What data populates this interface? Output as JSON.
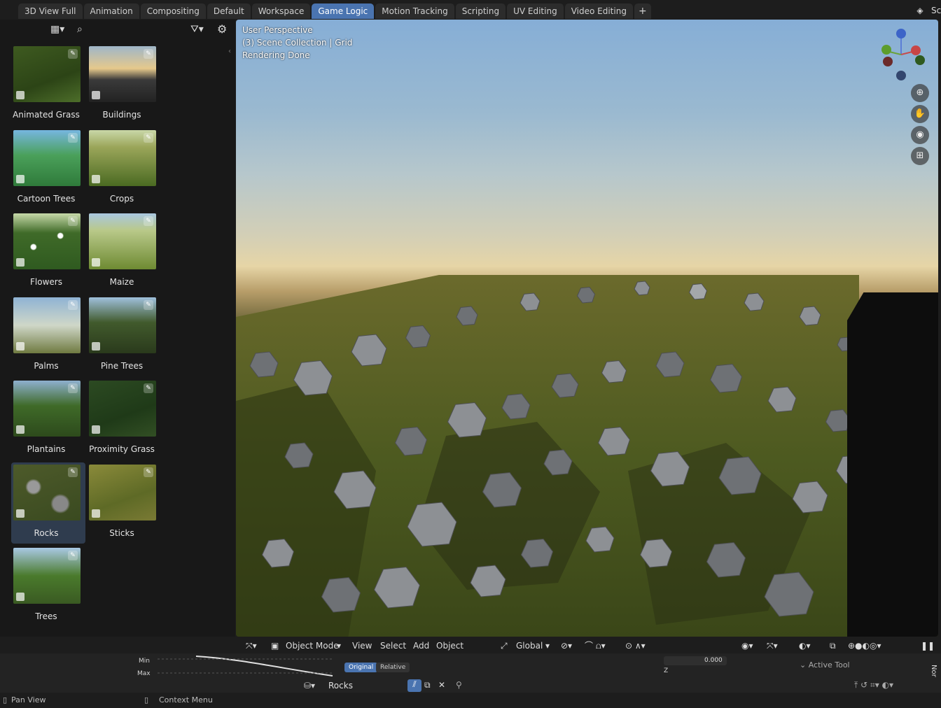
{
  "workspace_tabs": [
    "3D View Full",
    "Animation",
    "Compositing",
    "Default",
    "Workspace",
    "Game Logic",
    "Motion Tracking",
    "Scripting",
    "UV Editing",
    "Video Editing"
  ],
  "active_tab": "Game Logic",
  "add_tab_label": "+",
  "top_right": {
    "scene_abbrev": "Sc"
  },
  "assets": [
    {
      "label": "Animated Grass",
      "icon": "grass-thumbnail"
    },
    {
      "label": "Buildings",
      "icon": "buildings-thumbnail"
    },
    {
      "label": "Cartoon Trees",
      "icon": "cartoon-trees-thumbnail"
    },
    {
      "label": "Crops",
      "icon": "crops-thumbnail"
    },
    {
      "label": "Flowers",
      "icon": "flowers-thumbnail"
    },
    {
      "label": "Maize",
      "icon": "maize-thumbnail"
    },
    {
      "label": "Palms",
      "icon": "palms-thumbnail"
    },
    {
      "label": "Pine Trees",
      "icon": "pine-trees-thumbnail"
    },
    {
      "label": "Plantains",
      "icon": "plantains-thumbnail"
    },
    {
      "label": "Proximity Grass",
      "icon": "proximity-grass-thumbnail"
    },
    {
      "label": "Rocks",
      "icon": "rocks-thumbnail",
      "selected": true
    },
    {
      "label": "Sticks",
      "icon": "sticks-thumbnail"
    },
    {
      "label": "Trees",
      "icon": "trees-thumbnail"
    }
  ],
  "viewport": {
    "perspective": "User Perspective",
    "collection": "(3) Scene Collection | Grid",
    "status": "Rendering Done"
  },
  "viewport_header": {
    "mode": "Object Mode",
    "menu_view": "View",
    "menu_select": "Select",
    "menu_add": "Add",
    "menu_object": "Object",
    "orientation": "Global"
  },
  "bottom": {
    "min_label": "Min",
    "max_label": "Max",
    "original": "Original",
    "relative": "Relative",
    "y_label": "Y",
    "y_value": "0.000",
    "z_label": "Z",
    "active_tool": "Active Tool",
    "object_name": "Rocks",
    "side_tab": "Nor"
  },
  "status_bar": {
    "pan_view": "Pan View",
    "context_menu": "Context Menu"
  },
  "colors": {
    "accent": "#4a74b0",
    "panel": "#181818",
    "header": "#1d1d1d"
  }
}
